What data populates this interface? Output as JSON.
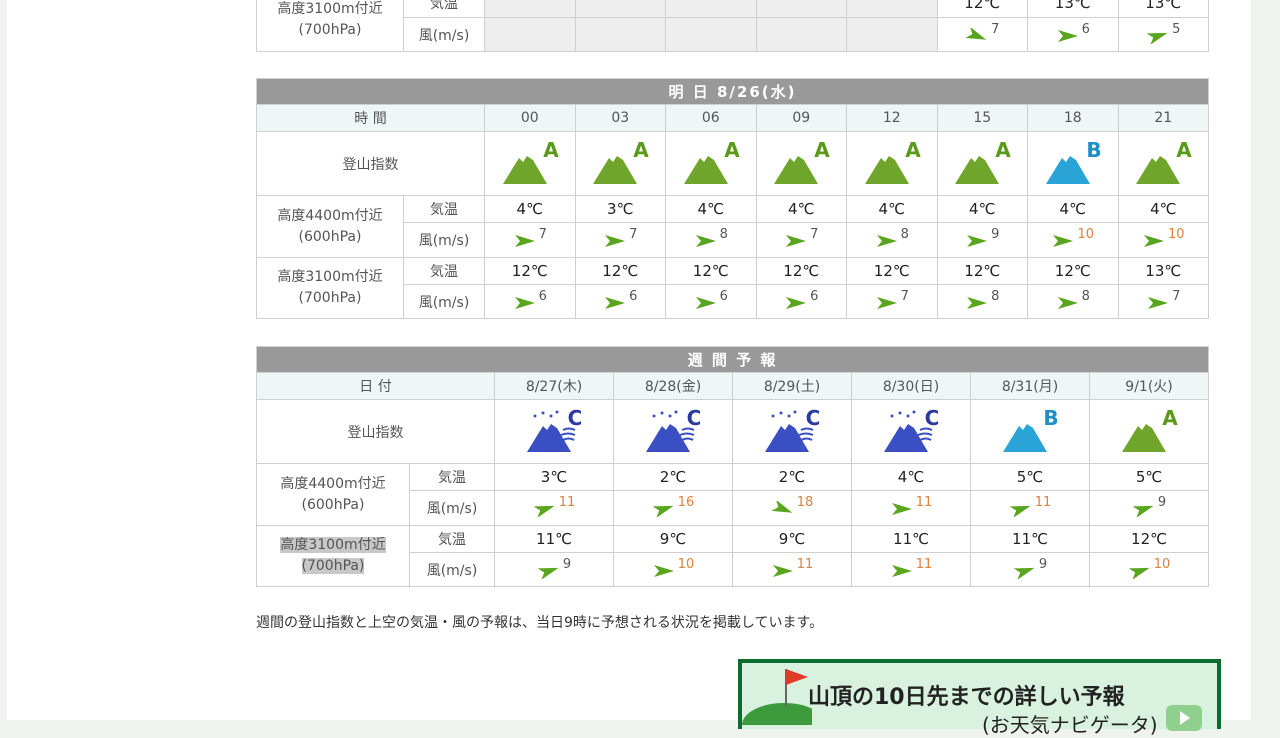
{
  "labels": {
    "climb_index": "登山指数",
    "temp": "気温",
    "wind": "風(m/s)",
    "alt4400": "高度4400m付近",
    "hpa600": "(600hPa)",
    "alt3100": "高度3100m付近",
    "hpa700": "(700hPa)",
    "time": "時 間",
    "date": "日 付"
  },
  "today_partial": {
    "temps": [
      "",
      "",
      "",
      "",
      "",
      "12℃",
      "13℃",
      "13℃"
    ],
    "winds": [
      null,
      null,
      null,
      null,
      null,
      {
        "v": "7",
        "dir": "down"
      },
      {
        "v": "6",
        "dir": "right"
      },
      {
        "v": "5",
        "dir": "up"
      }
    ]
  },
  "tomorrow": {
    "title": "明 日  8/26(水)",
    "times": [
      "00",
      "03",
      "06",
      "09",
      "12",
      "15",
      "18",
      "21"
    ],
    "index": [
      "A",
      "A",
      "A",
      "A",
      "A",
      "A",
      "B",
      "A"
    ],
    "t600": [
      "4℃",
      "3℃",
      "4℃",
      "4℃",
      "4℃",
      "4℃",
      "4℃",
      "4℃"
    ],
    "w600": [
      {
        "v": "7",
        "dir": "right"
      },
      {
        "v": "7",
        "dir": "right"
      },
      {
        "v": "8",
        "dir": "right"
      },
      {
        "v": "7",
        "dir": "right"
      },
      {
        "v": "8",
        "dir": "right"
      },
      {
        "v": "9",
        "dir": "right"
      },
      {
        "v": "10",
        "dir": "right",
        "hi": true
      },
      {
        "v": "10",
        "dir": "right",
        "hi": true
      }
    ],
    "t700": [
      "12℃",
      "12℃",
      "12℃",
      "12℃",
      "12℃",
      "12℃",
      "12℃",
      "13℃"
    ],
    "w700": [
      {
        "v": "6",
        "dir": "right"
      },
      {
        "v": "6",
        "dir": "right"
      },
      {
        "v": "6",
        "dir": "right"
      },
      {
        "v": "6",
        "dir": "right"
      },
      {
        "v": "7",
        "dir": "right"
      },
      {
        "v": "8",
        "dir": "right"
      },
      {
        "v": "8",
        "dir": "right"
      },
      {
        "v": "7",
        "dir": "right"
      }
    ]
  },
  "weekly": {
    "title": "週 間 予 報",
    "dates": [
      "8/27(木)",
      "8/28(金)",
      "8/29(土)",
      "8/30(日)",
      "8/31(月)",
      "9/1(火)"
    ],
    "index": [
      "C",
      "C",
      "C",
      "C",
      "B",
      "A"
    ],
    "t600": [
      "3℃",
      "2℃",
      "2℃",
      "4℃",
      "5℃",
      "5℃"
    ],
    "w600": [
      {
        "v": "11",
        "dir": "up",
        "hi": true
      },
      {
        "v": "16",
        "dir": "up",
        "hi": true
      },
      {
        "v": "18",
        "dir": "down",
        "hi": true
      },
      {
        "v": "11",
        "dir": "right",
        "hi": true
      },
      {
        "v": "11",
        "dir": "up",
        "hi": true
      },
      {
        "v": "9",
        "dir": "up"
      }
    ],
    "t700": [
      "11℃",
      "9℃",
      "9℃",
      "11℃",
      "11℃",
      "12℃"
    ],
    "w700": [
      {
        "v": "9",
        "dir": "up"
      },
      {
        "v": "10",
        "dir": "right",
        "hi": true
      },
      {
        "v": "11",
        "dir": "right",
        "hi": true
      },
      {
        "v": "11",
        "dir": "right",
        "hi": true
      },
      {
        "v": "9",
        "dir": "up"
      },
      {
        "v": "10",
        "dir": "up",
        "hi": true
      }
    ]
  },
  "note": "週間の登山指数と上空の気温・風の予報は、当日9時に予想される状況を掲載しています。",
  "banner": {
    "title": "山頂の10日先までの詳しい予報",
    "subtitle": "(お天気ナビゲータ)"
  },
  "colors": {
    "A": "#6fa52b",
    "B": "#2aa3d6",
    "C": "#3b4fc4",
    "letterA": "#5a9a1a",
    "letterB": "#1f8fc8",
    "letterC": "#2a3aa0",
    "arrow": "#5aa51e",
    "hi": "#e0803a"
  }
}
